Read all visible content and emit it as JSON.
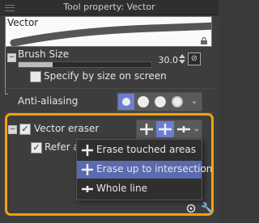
{
  "window": {
    "title": "Tool property: Vector"
  },
  "preview": {
    "tool_name": "Vector"
  },
  "brush_size": {
    "label": "Brush Size",
    "value": "30.0",
    "fill_fraction": 0.26
  },
  "specify_by_size": {
    "label": "Specify by size on screen",
    "checked": false
  },
  "anti_aliasing": {
    "label": "Anti-aliasing",
    "selected_index": 0,
    "options_count": 4
  },
  "vector_eraser": {
    "label": "Vector eraser",
    "checked": true,
    "selected_mode_index": 1
  },
  "refer": {
    "label": "Refer a",
    "checked": true
  },
  "eraser_menu": {
    "items": [
      {
        "label": "Erase touched areas",
        "selected": false
      },
      {
        "label": "Erase up to intersection",
        "selected": true
      },
      {
        "label": "Whole line",
        "selected": false
      }
    ]
  },
  "colors": {
    "accent": "#6a7fd1",
    "highlight_border": "#f5a200",
    "menu_selected": "#5a6bb0"
  }
}
